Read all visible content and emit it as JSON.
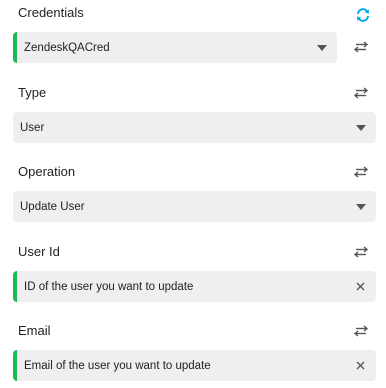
{
  "credentials": {
    "label": "Credentials",
    "value": "ZendeskQACred"
  },
  "type": {
    "label": "Type",
    "value": "User"
  },
  "operation": {
    "label": "Operation",
    "value": "Update User"
  },
  "user_id": {
    "label": "User Id",
    "placeholder": "ID of the user you want to update"
  },
  "email": {
    "label": "Email",
    "placeholder": "Email of the user you want to update"
  },
  "colors": {
    "accent": "#1db954",
    "refresh": "#00a8e8",
    "field_bg": "#efefef"
  },
  "icons": {
    "refresh": "refresh-icon",
    "swap": "swap-arrows-icon",
    "dropdown": "chevron-down-icon",
    "clear": "close-icon"
  }
}
